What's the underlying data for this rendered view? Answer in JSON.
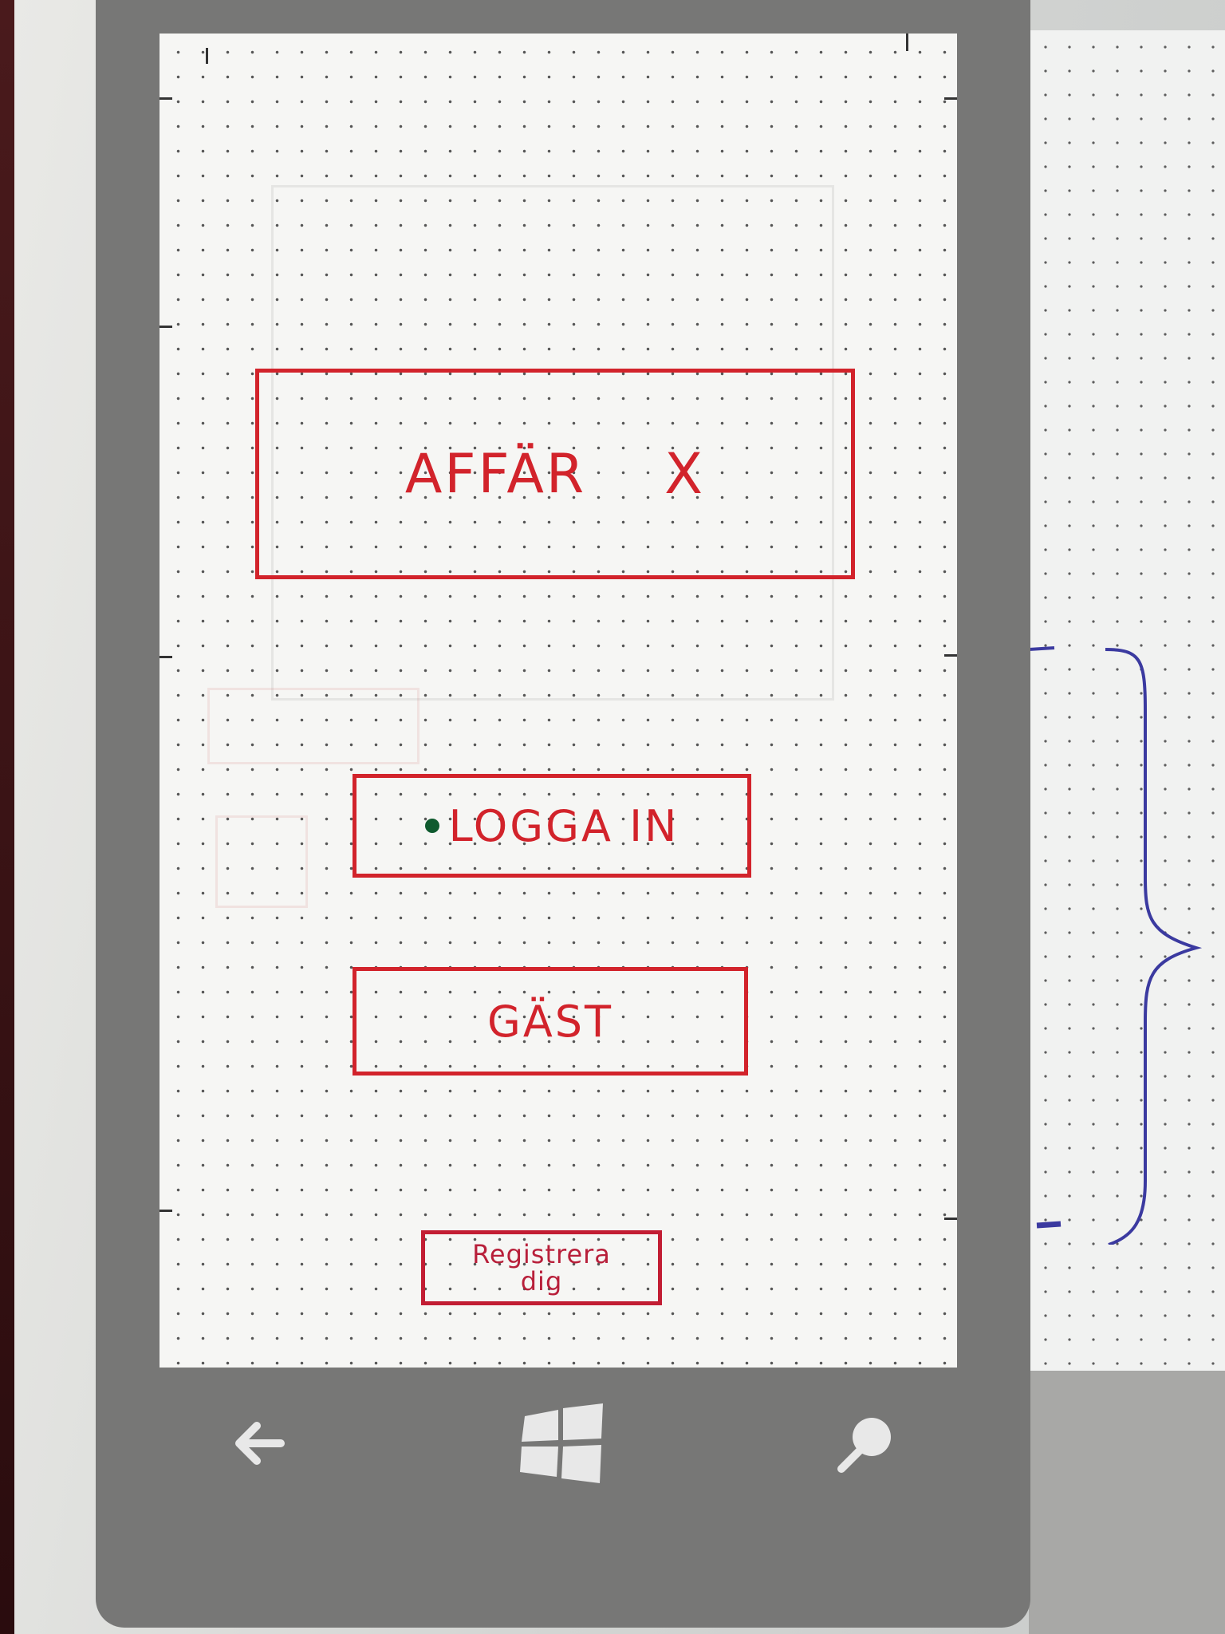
{
  "sketch": {
    "title_label": "AFFÄR",
    "title_close": "X",
    "login_label": "LOGGA  IN",
    "guest_label": "GÄST",
    "register_line1": "Registrera",
    "register_line2": "dig"
  },
  "nav": {
    "back_icon": "back-arrow-icon",
    "home_icon": "windows-logo-icon",
    "search_icon": "search-icon"
  },
  "colors": {
    "ink_red": "#d2232b",
    "ink_green": "#0f5a2e",
    "ink_blue": "#3b3aa0",
    "phone_frame": "#777776"
  }
}
